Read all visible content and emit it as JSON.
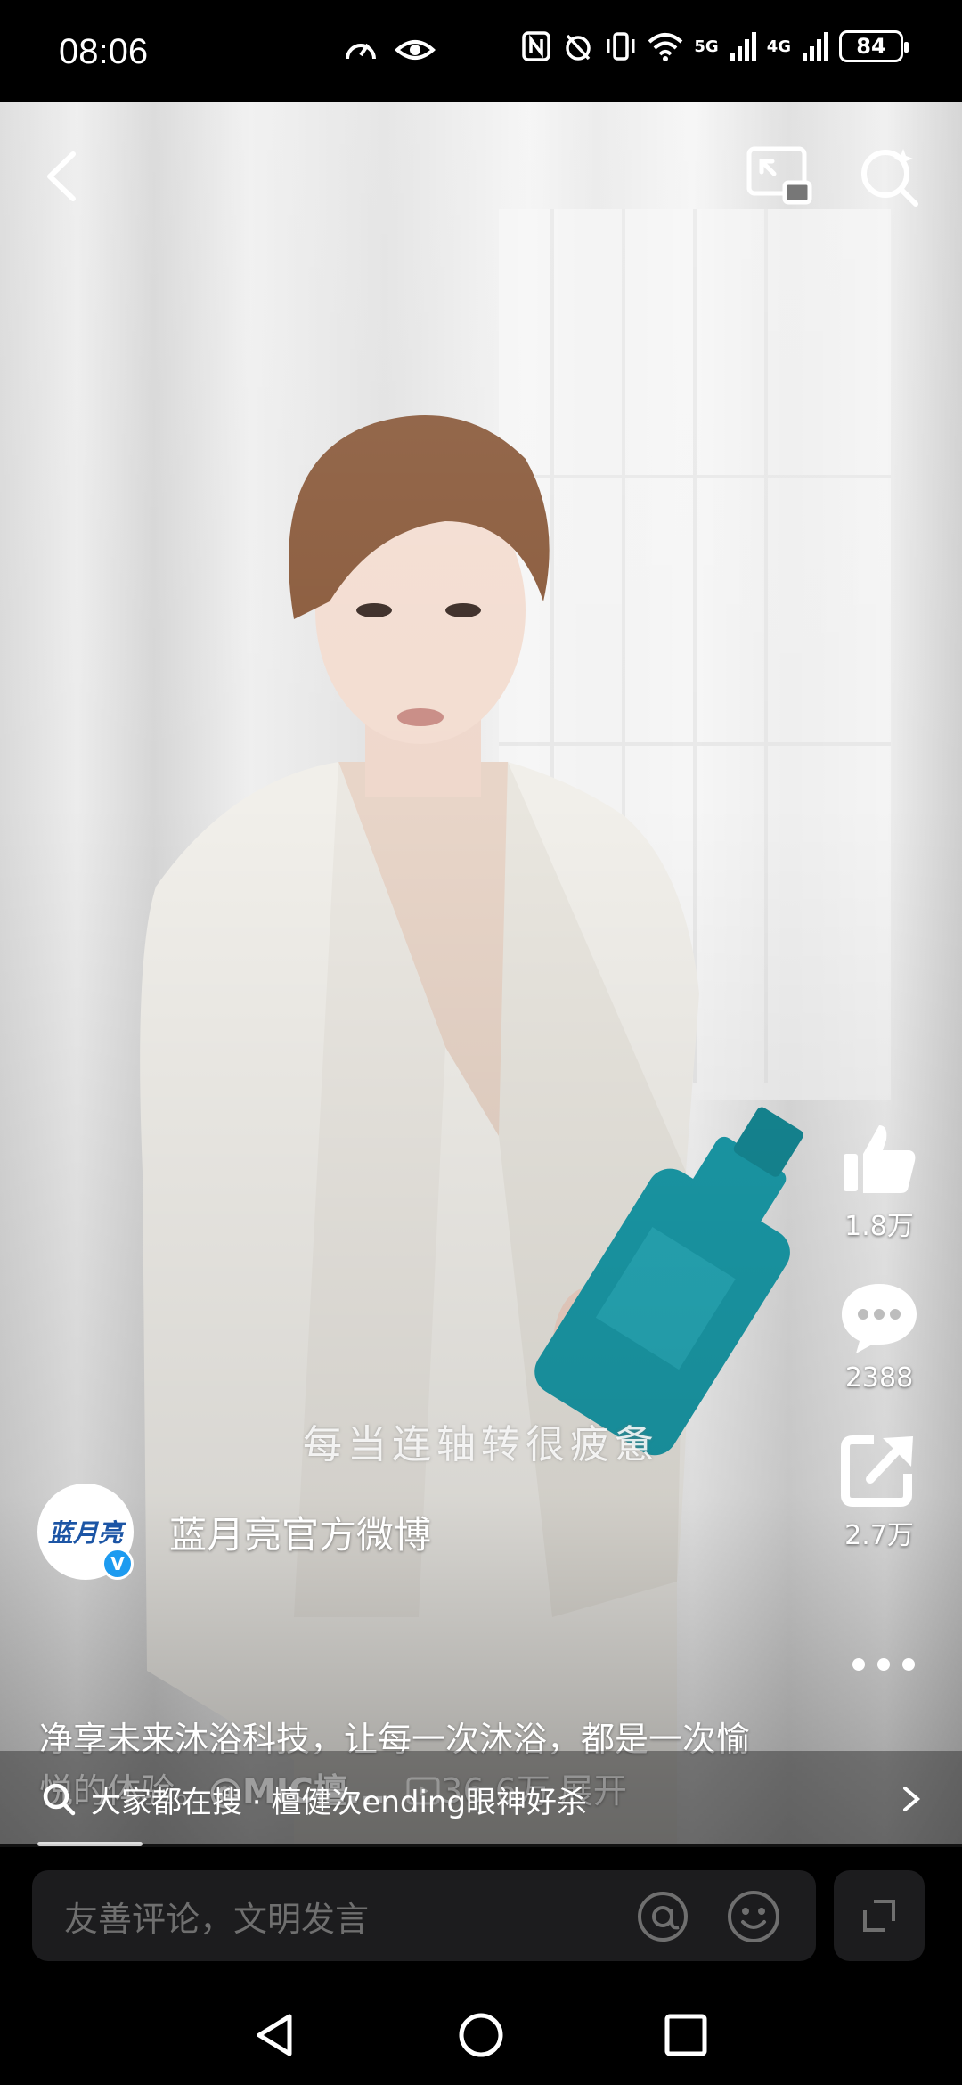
{
  "status_bar": {
    "time": "08:06",
    "network_5g": "5G",
    "network_4g": "4G",
    "battery": "84"
  },
  "video": {
    "subtitle": "每当连轴转很疲惫"
  },
  "actions": {
    "like_count": "1.8万",
    "comment_count": "2388",
    "share_count": "2.7万"
  },
  "author": {
    "logo_text": "蓝月亮",
    "verified_mark": "V",
    "name": "蓝月亮官方微博"
  },
  "caption": {
    "text": "净享未来沐浴科技，让每一次沐浴，都是一次愉悦的体验。",
    "mention": "@MIC檀...",
    "views": "36.6万",
    "expand": "展开"
  },
  "search_suggestion": {
    "text": "大家都在搜 · 檀健次ending眼神好杀"
  },
  "comment_bar": {
    "placeholder": "友善评论，文明发言"
  },
  "colors": {
    "verified": "#1d9bf0",
    "brand_blue": "#1c55a5",
    "bottle": "#1a9aa8"
  }
}
